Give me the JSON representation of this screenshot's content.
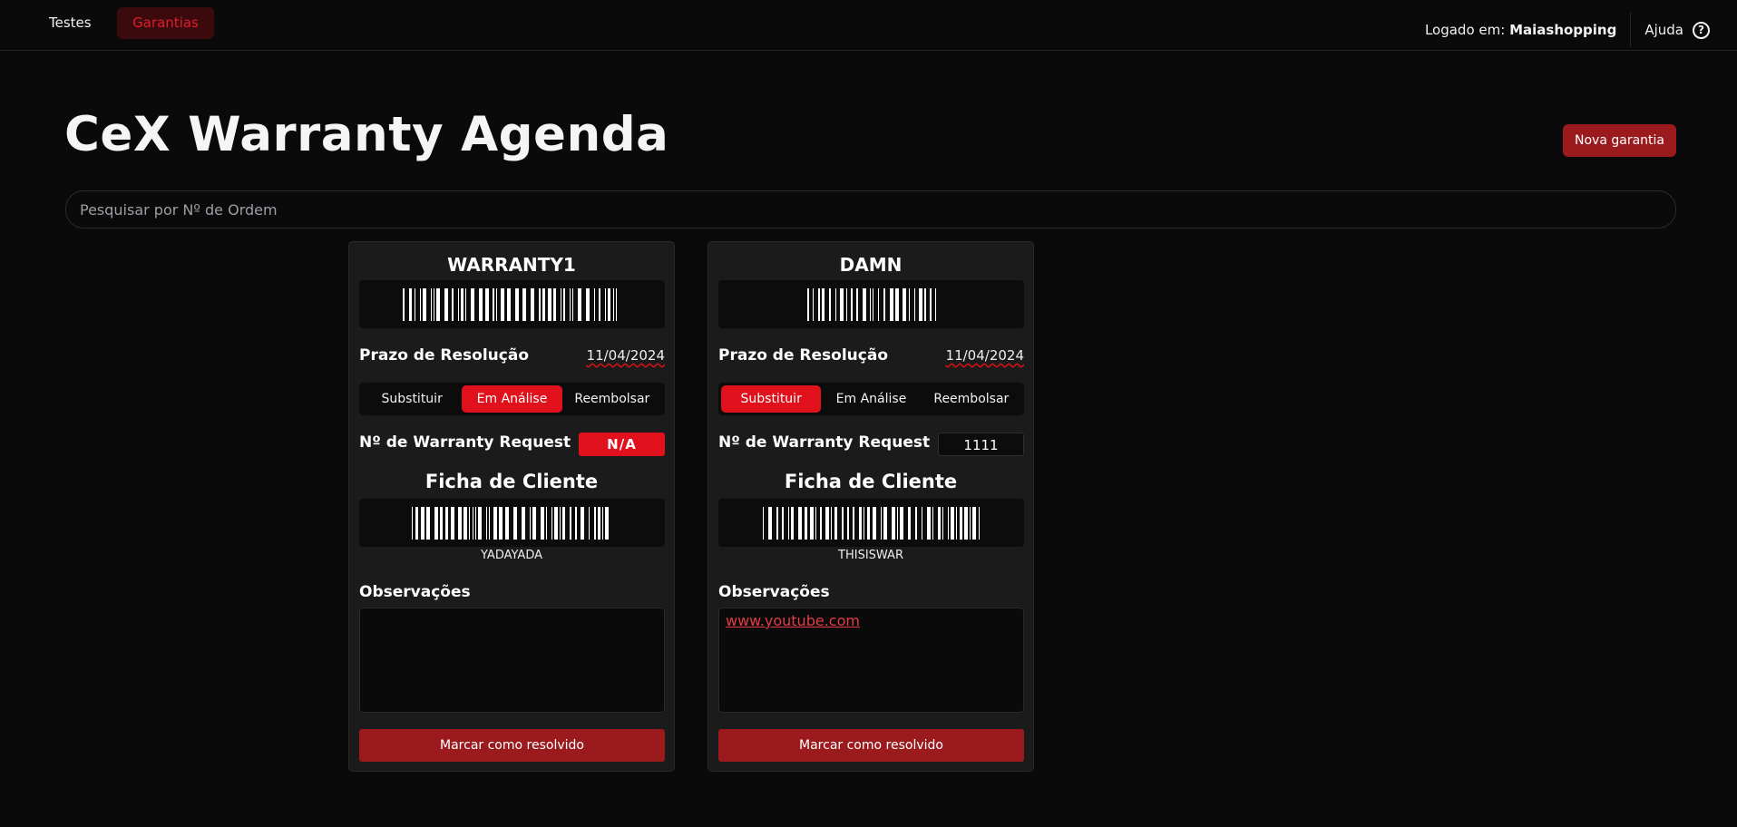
{
  "nav": {
    "tabs": [
      {
        "label": "Testes"
      },
      {
        "label": "Garantias",
        "active": true
      }
    ],
    "logged_prefix": "Logado em:",
    "logged_user": "Maiashopping",
    "help_label": "Ajuda",
    "help_icon": "?"
  },
  "header": {
    "title": "CeX Warranty Agenda",
    "new_button": "Nova garantia"
  },
  "search": {
    "placeholder": "Pesquisar por Nº de Ordem",
    "value": ""
  },
  "labels": {
    "deadline": "Prazo de Resolução",
    "warranty_request": "Nº de Warranty Request",
    "client_sheet": "Ficha de Cliente",
    "observations": "Observações",
    "resolve_button": "Marcar como resolvido",
    "options": [
      "Substituir",
      "Em Análise",
      "Reembolsar"
    ]
  },
  "cards": [
    {
      "title": "WARRANTY1",
      "deadline": "11/04/2024",
      "selected_option": "Em Análise",
      "warranty_request": "N/A",
      "client_code": "YADAYADA",
      "observations": ""
    },
    {
      "title": "DAMN",
      "deadline": "11/04/2024",
      "selected_option": "Substituir",
      "warranty_request": "1111",
      "client_code": "THISISWAR",
      "observations": "www.youtube.com"
    }
  ],
  "colors": {
    "accent": "#e0111c",
    "button_red": "#9b1a1e",
    "background": "#0a0a0a",
    "card": "#1b1b1b"
  }
}
